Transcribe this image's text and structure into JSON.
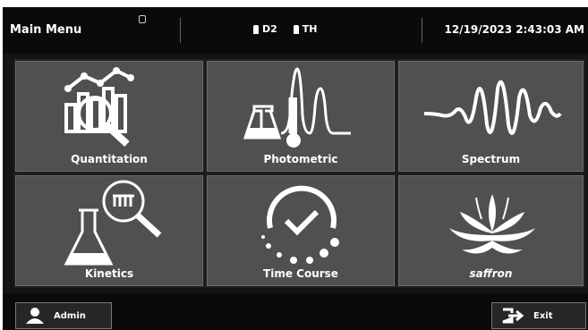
{
  "header": {
    "title": "Main Menu",
    "status_items": [
      {
        "icon": "bottle-icon",
        "label": "D2"
      },
      {
        "icon": "lamp-icon",
        "label": "TH"
      }
    ],
    "datetime": "12/19/2023 2:43:03 AM"
  },
  "tiles": [
    {
      "label": "Quantitation",
      "icon": "quantitation-icon"
    },
    {
      "label": "Photometric",
      "icon": "photometric-icon"
    },
    {
      "label": "Spectrum",
      "icon": "spectrum-icon"
    },
    {
      "label": "Kinetics",
      "icon": "kinetics-icon"
    },
    {
      "label": "Time Course",
      "icon": "time-course-icon"
    },
    {
      "label": "saffron",
      "icon": "lotus-logo-icon"
    }
  ],
  "footer": {
    "user_label": "Admin",
    "exit_label": "Exit"
  },
  "colors": {
    "tile_bg": "#505050",
    "screen_bg": "#141414",
    "text": "#ffffff"
  }
}
